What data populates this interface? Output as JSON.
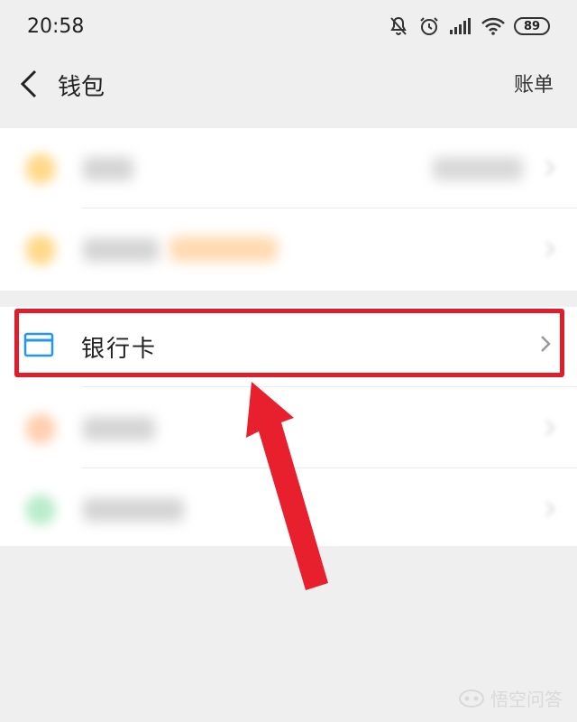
{
  "status_bar": {
    "time": "20:58",
    "battery": "89",
    "icons": [
      "mute-bell-icon",
      "alarm-icon",
      "signal-icon",
      "wifi-icon",
      "battery-icon"
    ]
  },
  "nav": {
    "title": "钱包",
    "action": "账单",
    "back_icon": "chevron-left-icon"
  },
  "section1": {
    "rows": [
      {
        "icon": "blurred-yellow-icon",
        "icon_color": "#ffd98a"
      },
      {
        "icon": "blurred-yellow-icon",
        "icon_color": "#ffd98a"
      }
    ]
  },
  "section2": {
    "bank_card": {
      "label": "银行卡",
      "icon": "card-icon",
      "icon_color": "#2196f3"
    },
    "rows": [
      {
        "icon": "blurred-orange-icon",
        "icon_color": "#ffcfb0"
      },
      {
        "icon": "blurred-green-icon",
        "icon_color": "#b9eccc"
      }
    ]
  },
  "highlight_color": "#e01e2b",
  "watermark": {
    "text": "悟空问答",
    "icon": "wukong-logo-icon"
  }
}
